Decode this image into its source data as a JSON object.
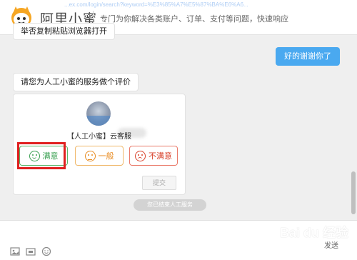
{
  "header": {
    "brand": "阿里小蜜",
    "tagline": "专门为你解决各类账户、订单、支付等问题，快速响应",
    "url_text": "...ex.com/login/search?keyword=%E3%85%A7%E5%87%BA%E6%A6..."
  },
  "messages": {
    "top_bubble": "举否复制粘贴浏览器打开",
    "user_bubble": "好的谢谢你了",
    "rate_prompt": "请您为人工小蜜的服务做个评价"
  },
  "rating": {
    "agent_name": "【人工小蜜】云客服",
    "options": [
      {
        "label": "满意",
        "tone": "good"
      },
      {
        "label": "一般",
        "tone": "neutral"
      },
      {
        "label": "不满意",
        "tone": "bad"
      }
    ],
    "submit": "提交"
  },
  "transfer_button": "您已结束人工服务",
  "input": {
    "send": "发送"
  },
  "watermark": "Bai du 经验",
  "colors": {
    "accent": "#4aa9f0",
    "good": "#3aa052",
    "neutral": "#e88a1f",
    "bad": "#d9432c",
    "highlight": "#e02020"
  },
  "icons": [
    "bee-logo-icon",
    "smile-icon",
    "neutral-face-icon",
    "sad-face-icon",
    "image-icon",
    "emoji-icon",
    "screenshot-icon"
  ]
}
